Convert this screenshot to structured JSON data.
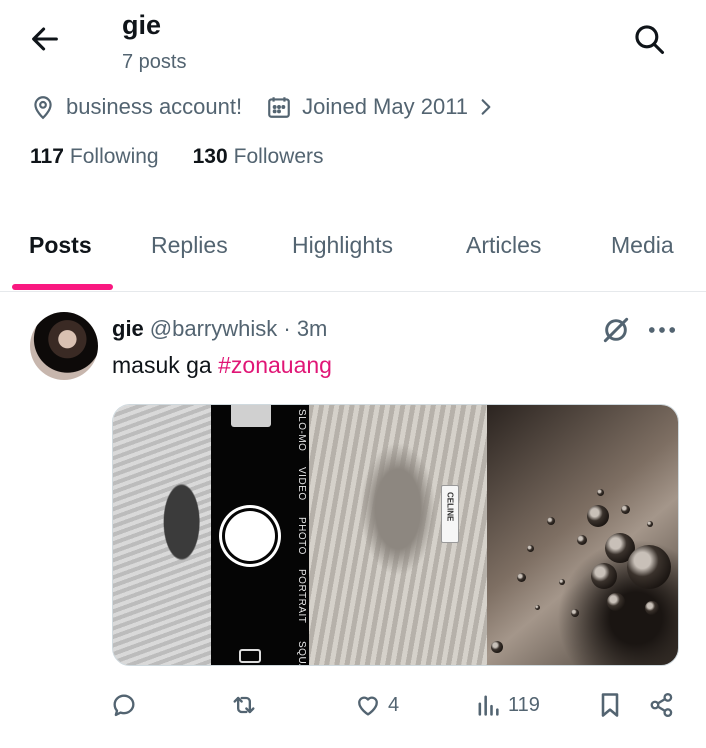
{
  "header": {
    "title": "gie",
    "subtitle": "7 posts"
  },
  "profile": {
    "location": "business account!",
    "joined": "Joined May 2011",
    "following_count": "117",
    "following_label": "Following",
    "followers_count": "130",
    "followers_label": "Followers"
  },
  "tabs": [
    {
      "label": "Posts",
      "active": true
    },
    {
      "label": "Replies",
      "active": false
    },
    {
      "label": "Highlights",
      "active": false
    },
    {
      "label": "Articles",
      "active": false
    },
    {
      "label": "Media",
      "active": false
    }
  ],
  "post": {
    "name": "gie",
    "handle_time": "@barrywhisk · 3m",
    "text": "masuk ga ",
    "hashtag": "#zonauang",
    "media": {
      "camera_modes": [
        "SLO-MO",
        "VIDEO",
        "PHOTO",
        "PORTRAIT",
        "SQUA"
      ],
      "label_text": "CELINE"
    },
    "actions": {
      "replies": "",
      "reposts": "",
      "likes": "4",
      "views": "119"
    }
  },
  "icons": {
    "back": "arrow-left-icon",
    "search": "search-icon",
    "location": "location-pin-icon",
    "calendar": "calendar-icon",
    "grok": "grok-icon",
    "more": "more-dots-icon",
    "reply": "reply-icon",
    "repost": "repost-icon",
    "like": "heart-icon",
    "views": "views-icon",
    "bookmark": "bookmark-icon",
    "share": "share-icon"
  },
  "colors": {
    "accent": "#f91880",
    "hashtag": "#e01676",
    "secondary_text": "#536471",
    "primary_text": "#0f1419"
  }
}
